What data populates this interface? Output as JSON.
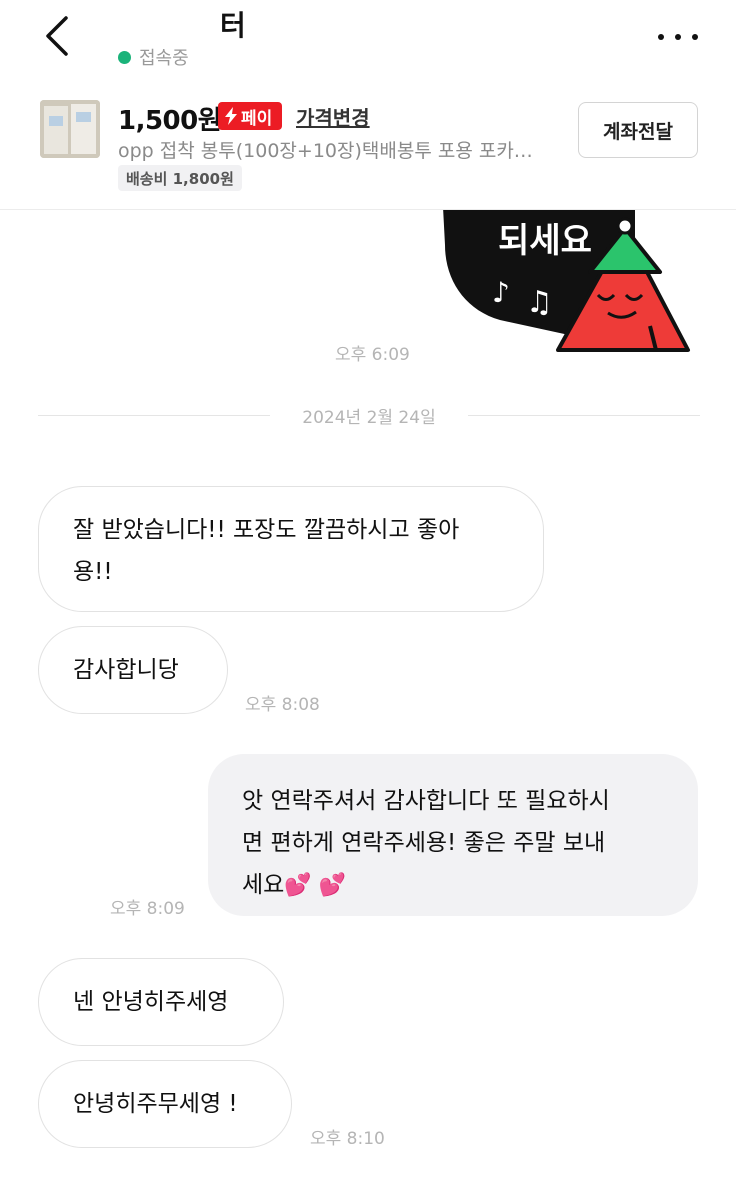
{
  "header": {
    "title": "터",
    "status": "접속중",
    "icons": [
      "chevron-left-icon",
      "more-icon"
    ]
  },
  "product": {
    "price": "1,500원",
    "pay_label": "페이",
    "price_change_label": "가격변경",
    "name": "opp 접착 봉투(100장+10장)택배봉투 포용 포카…",
    "shipping": "배송비 1,800원",
    "transfer_button": "계좌전달"
  },
  "chat": {
    "sticker": {
      "text": "되세요",
      "time": "오후 6:09"
    },
    "date_divider": "2024년 2월 24일",
    "messages": [
      {
        "side": "in",
        "text_line1": "잘 받았습니다!! 포장도 깔끔하시고 좋아",
        "text_line2": "용!!"
      },
      {
        "side": "in",
        "text": "감사합니당",
        "time": "오후 8:08"
      },
      {
        "side": "out",
        "text_line1": "앗 연락주셔서 감사합니다 또 필요하시",
        "text_line2": "면 편하게 연락주세용! 좋은 주말 보내",
        "text_line3": "세요",
        "emoji": "💕 💕",
        "time": "오후 8:09"
      },
      {
        "side": "in",
        "text": "넨 안녕히주세영"
      },
      {
        "side": "in",
        "text": "안녕히주무세영 !",
        "time": "오후 8:10"
      }
    ]
  },
  "colors": {
    "online": "#1bb37a",
    "pay_badge": "#ec1c24",
    "sticker_bg": "#111111",
    "sticker_hat": "#2bc46c",
    "sticker_face": "#ee3b38"
  }
}
